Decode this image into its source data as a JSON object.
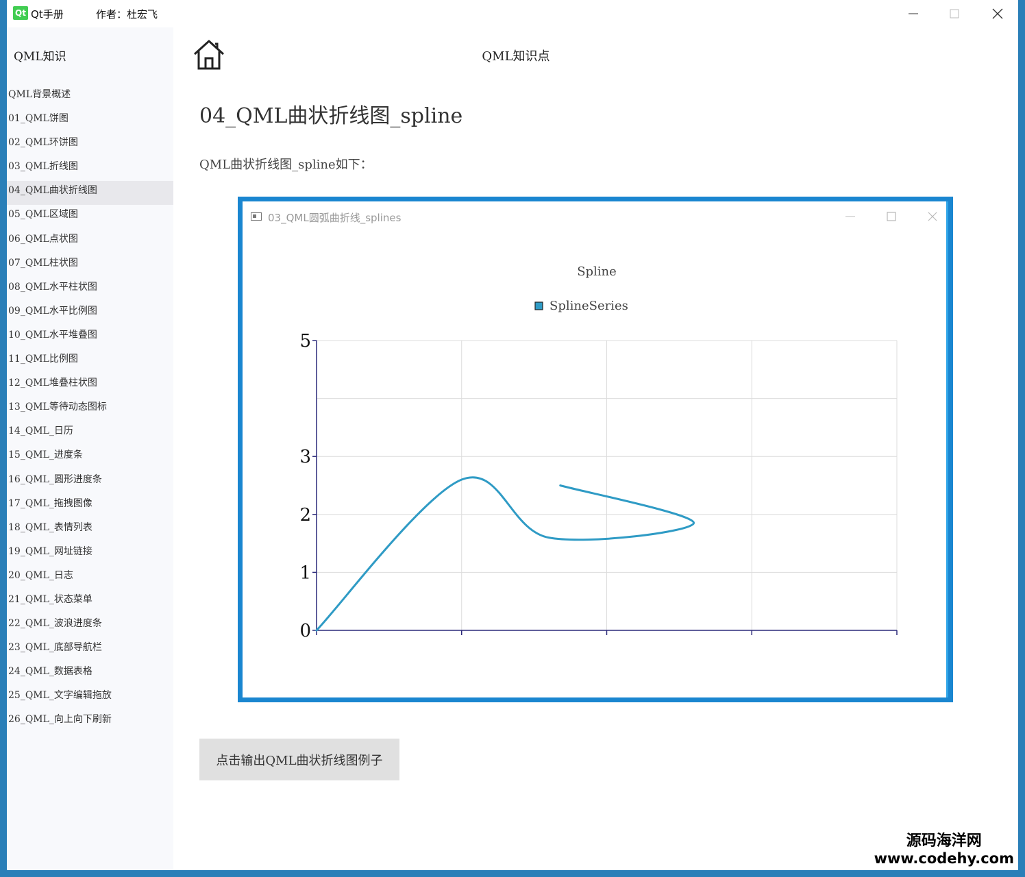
{
  "window": {
    "logo_text": "Qt",
    "app_title": "Qt手册",
    "author": "作者：杜宏飞"
  },
  "sidebar": {
    "title": "QML知识",
    "active_index": 4,
    "items": [
      "QML背景概述",
      "01_QML饼图",
      "02_QML环饼图",
      "03_QML折线图",
      "04_QML曲状折线图",
      "05_QML区域图",
      "06_QML点状图",
      "07_QML柱状图",
      "08_QML水平柱状图",
      "09_QML水平比例图",
      "10_QML水平堆叠图",
      "11_QML比例图",
      "12_QML堆叠柱状图",
      "13_QML等待动态图标",
      "14_QML_日历",
      "15_QML_进度条",
      "16_QML_圆形进度条",
      "17_QML_拖拽图像",
      "18_QML_表情列表",
      "19_QML_网址链接",
      "20_QML_日志",
      "21_QML_状态菜单",
      "22_QML_波浪进度条",
      "23_QML_底部导航栏",
      "24_QML_数据表格",
      "25_QML_文字编辑拖放",
      "26_QML_向上向下刷新"
    ]
  },
  "header": {
    "home_icon": "home-icon",
    "title": "QML知识点"
  },
  "content": {
    "page_title": "04_QML曲状折线图_spline",
    "intro": "QML曲状折线图_spline如下：",
    "button_label": "点击输出QML曲状折线图例子"
  },
  "embedded_window": {
    "title": "03_QML圆弧曲折线_splines",
    "icon": "window-icon",
    "accent": "#1a86d0"
  },
  "chart_data": {
    "type": "line",
    "title": "Spline",
    "xlabel": "",
    "ylabel": "",
    "ylim": [
      0,
      5
    ],
    "xlim": [
      0,
      4
    ],
    "y_ticks": [
      0,
      1,
      2,
      3,
      5
    ],
    "x_ticks": [
      0,
      1,
      2,
      3,
      4
    ],
    "grid": true,
    "legend": "top-center",
    "series": [
      {
        "name": "SplineSeries",
        "color": "#2f9bc5",
        "x": [
          0,
          1,
          1.6,
          2.6,
          1.68
        ],
        "y": [
          0,
          2.6,
          1.6,
          1.85,
          2.5
        ]
      }
    ]
  },
  "watermark": {
    "text": "源码海洋网",
    "url": "www.codehy.com"
  }
}
